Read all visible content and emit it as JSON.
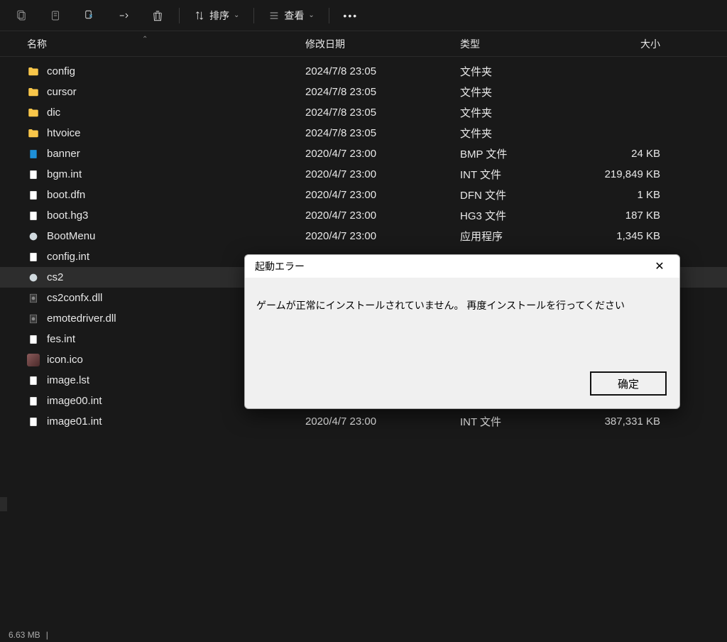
{
  "toolbar": {
    "sort_label": "排序",
    "view_label": "查看"
  },
  "columns": {
    "name": "名称",
    "date": "修改日期",
    "type": "类型",
    "size": "大小"
  },
  "rows": [
    {
      "icon": "folder",
      "name": "config",
      "date": "2024/7/8 23:05",
      "type": "文件夹",
      "size": ""
    },
    {
      "icon": "folder",
      "name": "cursor",
      "date": "2024/7/8 23:05",
      "type": "文件夹",
      "size": ""
    },
    {
      "icon": "folder",
      "name": "dic",
      "date": "2024/7/8 23:05",
      "type": "文件夹",
      "size": ""
    },
    {
      "icon": "folder",
      "name": "htvoice",
      "date": "2024/7/8 23:05",
      "type": "文件夹",
      "size": ""
    },
    {
      "icon": "file-blue",
      "name": "banner",
      "date": "2020/4/7 23:00",
      "type": "BMP 文件",
      "size": "24 KB"
    },
    {
      "icon": "file",
      "name": "bgm.int",
      "date": "2020/4/7 23:00",
      "type": "INT 文件",
      "size": "219,849 KB"
    },
    {
      "icon": "file",
      "name": "boot.dfn",
      "date": "2020/4/7 23:00",
      "type": "DFN 文件",
      "size": "1 KB"
    },
    {
      "icon": "file",
      "name": "boot.hg3",
      "date": "2020/4/7 23:00",
      "type": "HG3 文件",
      "size": "187 KB"
    },
    {
      "icon": "app",
      "name": "BootMenu",
      "date": "2020/4/7 23:00",
      "type": "应用程序",
      "size": "1,345 KB"
    },
    {
      "icon": "file",
      "name": "config.int",
      "date": "",
      "type": "",
      "size": ""
    },
    {
      "icon": "app",
      "name": "cs2",
      "date": "",
      "type": "",
      "size": "",
      "selected": true
    },
    {
      "icon": "dll",
      "name": "cs2confx.dll",
      "date": "",
      "type": "",
      "size": ""
    },
    {
      "icon": "dll",
      "name": "emotedriver.dll",
      "date": "",
      "type": "",
      "size": ""
    },
    {
      "icon": "file",
      "name": "fes.int",
      "date": "",
      "type": "",
      "size": ""
    },
    {
      "icon": "ico",
      "name": "icon.ico",
      "date": "",
      "type": "",
      "size": ""
    },
    {
      "icon": "file",
      "name": "image.lst",
      "date": "",
      "type": "",
      "size": ""
    },
    {
      "icon": "file",
      "name": "image00.int",
      "date": "",
      "type": "",
      "size": ""
    },
    {
      "icon": "file",
      "name": "image01.int",
      "date": "2020/4/7 23:00",
      "type": "INT 文件",
      "size": "387,331 KB"
    }
  ],
  "dialog": {
    "title": "起動エラー",
    "message": "ゲームが正常にインストールされていません。 再度インストールを行ってください",
    "ok": "确定"
  },
  "status": {
    "text": "6.63 MB"
  }
}
